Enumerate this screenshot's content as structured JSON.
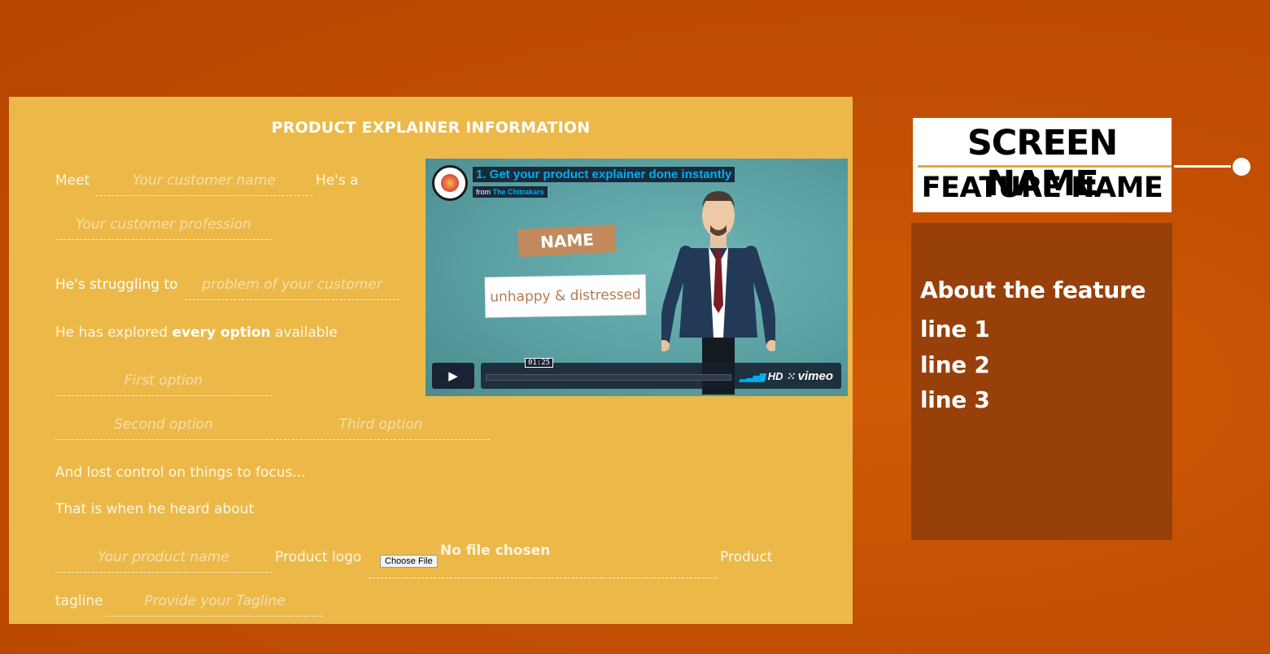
{
  "form": {
    "title": "PRODUCT EXPLAINER INFORMATION",
    "meet_label": "Meet",
    "customer_name_placeholder": "Your customer name",
    "hes_a_label": "He's a",
    "profession_placeholder": "Your customer profession",
    "struggling_label": "He's struggling to",
    "problem_placeholder": "problem of your customer",
    "explored_prefix": "He has explored",
    "explored_bold": "every option",
    "explored_suffix": "available",
    "first_option_placeholder": "First option",
    "second_option_placeholder": "Second option",
    "third_option_placeholder": "Third option",
    "lost_control_text": "And lost control on things to focus...",
    "heard_about_text": "That is when he heard about",
    "product_name_placeholder": "Your product name",
    "product_logo_label": "Product logo",
    "choose_file_label": "Choose File",
    "no_file_text": "No file chosen",
    "product_label": "Product",
    "tagline_label": "tagline",
    "tagline_placeholder": "Provide your Tagline"
  },
  "video": {
    "title": "1. Get your product explainer done instantly",
    "from_label": "from",
    "channel": "The Chitrakars",
    "name_card": "NAME",
    "subtitle_card": "unhappy & distressed",
    "time": "01:25",
    "hd_label": "HD",
    "vimeo_label": "vimeo"
  },
  "sidebar": {
    "screen_name": "SCREEN NAME",
    "feature_name": "FEATURE NAME",
    "about_title": "About the feature",
    "lines": [
      "line 1",
      "line 2",
      "line 3"
    ]
  }
}
